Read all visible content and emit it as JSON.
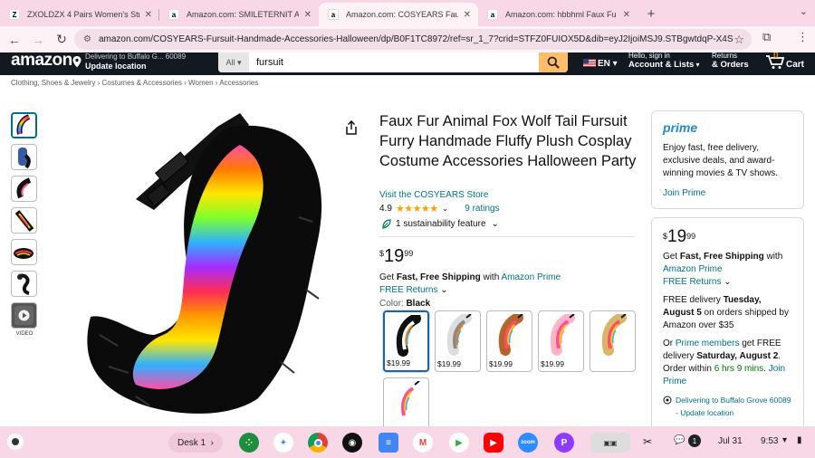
{
  "browser": {
    "tabs": [
      {
        "title": "ZXOLDZX 4 Pairs Women's Stri",
        "favicon": "Z",
        "active": false
      },
      {
        "title": "Amazon.com: SMILETERNIT A",
        "favicon": "a",
        "active": false
      },
      {
        "title": "Amazon.com: COSYEARS Faux",
        "favicon": "a",
        "active": true
      },
      {
        "title": "Amazon.com: hbbhml Faux Fu",
        "favicon": "a",
        "active": false
      }
    ],
    "url": "amazon.com/COSYEARS-Fursuit-Handmade-Accessories-Halloween/dp/B0F1TC8972/ref=sr_1_7?crid=STFZ0FUIOX5D&dib=eyJ2IjoiMSJ9.STBgwtdqP-X4S0A..."
  },
  "amazon_nav": {
    "logo": "amazon",
    "deliver_line1": "Delivering to Buffalo G... 60089",
    "deliver_line2": "Update location",
    "search_category": "All",
    "search_query": "fursuit",
    "language": "EN",
    "account_line1": "Hello, sign in",
    "account_line2": "Account & Lists",
    "returns_line1": "Returns",
    "returns_line2": "& Orders",
    "cart_count": "0",
    "cart_label": "Cart"
  },
  "breadcrumbs": [
    "Clothing, Shoes & Jewelry",
    "Costumes & Accessories",
    "Women",
    "Accessories"
  ],
  "thumbnails": {
    "video_label": "VIDEO"
  },
  "product": {
    "title": "Faux Fur Animal Fox Wolf Tail Fursuit Furry Handmade Fluffy Plush Cosplay Costume Accessories Halloween Party",
    "store": "Visit the COSYEARS Store",
    "rating": "4.9",
    "ratings_count": "9 ratings",
    "sustainability": "1 sustainability feature",
    "price_symbol": "$",
    "price_whole": "19",
    "price_fraction": "99",
    "shipping_prefix": "Get ",
    "shipping_bold": "Fast, Free Shipping",
    "shipping_with": " with ",
    "shipping_link": "Amazon Prime",
    "free_returns": "FREE Returns",
    "color_label": "Color: ",
    "color_value": "Black",
    "swatches": [
      {
        "price": "$19.99",
        "colors": [
          "#111111",
          "#ffffff",
          "#ff7a00",
          "#2fb0ff"
        ]
      },
      {
        "price": "$19.99",
        "colors": [
          "#dddddd",
          "#8a8a8a",
          "#ff7a00",
          "#2fb0ff"
        ]
      },
      {
        "price": "$19.99",
        "colors": [
          "#b5642b",
          "#ff4d6d",
          "#ffd000",
          "#2fb0ff"
        ]
      },
      {
        "price": "$19.99",
        "colors": [
          "#ffb3c6",
          "#ff4d9a",
          "#ffd000",
          "#ff8fb0"
        ]
      },
      {
        "price": "",
        "colors": [
          "#d9b56a",
          "#ff4d6d",
          "#ffd000",
          "#2fb0ff"
        ]
      },
      {
        "price": "",
        "colors": [
          "#ffffff",
          "#ff4d9a",
          "#ffd000",
          "#2fb0ff"
        ]
      }
    ]
  },
  "prime_box": {
    "logo": "prime",
    "text": "Enjoy fast, free delivery, exclusive deals, and award-winning movies & TV shows.",
    "join": "Join Prime"
  },
  "buy_box": {
    "price_symbol": "$",
    "price_whole": "19",
    "price_fraction": "99",
    "ship_prefix": "Get ",
    "ship_bold": "Fast, Free Shipping",
    "ship_with": " with",
    "ship_link": "Amazon Prime",
    "free_returns": "FREE Returns",
    "delivery_prefix": "FREE delivery ",
    "delivery_date": "Tuesday, August 5",
    "delivery_suffix": " on orders shipped by Amazon over $35",
    "or": "Or ",
    "prime_members": "Prime members",
    "fastest_prefix": " get FREE delivery ",
    "fastest_date": "Saturday, August 2",
    "order_within": ". Order within ",
    "countdown": "6 hrs 9 mins",
    "period": ". ",
    "join_prime": "Join Prime",
    "deliver_to": "Delivering to Buffalo Grove 60089 - Update location"
  },
  "taskbar": {
    "desk": "Desk 1",
    "date": "Jul 31",
    "time": "9:53",
    "notification_count": "1"
  },
  "colors": {
    "amazon_dark": "#131921",
    "link": "#007185",
    "star": "#f7a200",
    "search_button": "#febd69",
    "chrome_pink": "#f8d8e6"
  }
}
